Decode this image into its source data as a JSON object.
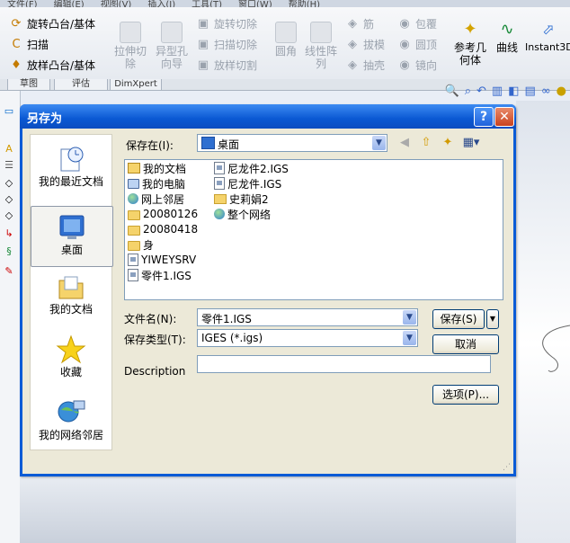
{
  "app": {
    "menu": [
      "文件(F)",
      "编辑(E)",
      "视图(V)",
      "插入(I)",
      "工具(T)",
      "窗口(W)",
      "帮助(H)"
    ],
    "ribbon": {
      "left_items": [
        "旋转凸台/基体",
        "扫描",
        "放样凸台/基体"
      ],
      "mid_items": [
        "拉伸切除",
        "异型孔向导"
      ],
      "cut_items": [
        "旋转切除",
        "扫描切除",
        "放样切割"
      ],
      "feature_items": [
        "圆角",
        "线性阵列"
      ],
      "right_items": [
        "筋",
        "拔模",
        "抽壳",
        "包覆",
        "圆顶",
        "镜向"
      ],
      "big_items": [
        "参考几何体",
        "曲线",
        "Instant3D"
      ]
    },
    "tabs": [
      "草图",
      "评估",
      "DimXpert"
    ]
  },
  "dialog": {
    "title": "另存为",
    "save_in_label": "保存在(I):",
    "save_in_value": "桌面",
    "places": [
      {
        "label": "我的最近文档",
        "icon": "recent-documents-icon"
      },
      {
        "label": "桌面",
        "icon": "desktop-icon"
      },
      {
        "label": "我的文档",
        "icon": "my-documents-icon"
      },
      {
        "label": "收藏",
        "icon": "favorites-icon"
      },
      {
        "label": "我的网络邻居",
        "icon": "network-places-icon"
      }
    ],
    "files_col1": [
      {
        "name": "我的文档",
        "icon": "my-documents-icon"
      },
      {
        "name": "我的电脑",
        "icon": "computer-icon"
      },
      {
        "name": "网上邻居",
        "icon": "network-icon"
      },
      {
        "name": "20080126",
        "icon": "folder-icon"
      },
      {
        "name": "20080418",
        "icon": "folder-icon"
      },
      {
        "name": "身",
        "icon": "folder-icon"
      },
      {
        "name": "YIWEYSRV",
        "icon": "network-drive-icon"
      },
      {
        "name": "零件1.IGS",
        "icon": "igs-file-icon"
      }
    ],
    "files_col2": [
      {
        "name": "尼龙件2.IGS",
        "icon": "igs-file-icon"
      },
      {
        "name": "尼龙件.IGS",
        "icon": "igs-file-icon"
      },
      {
        "name": "史莉娟2",
        "icon": "shared-folder-icon"
      },
      {
        "name": "整个网络",
        "icon": "entire-network-icon"
      }
    ],
    "filename_label": "文件名(N):",
    "filename_value": "零件1.IGS",
    "filetype_label": "保存类型(T):",
    "filetype_value": "IGES (*.igs)",
    "description_label": "Description",
    "description_value": "",
    "save_button": "保存(S)",
    "cancel_button": "取消",
    "options_button": "选项(P)..."
  }
}
